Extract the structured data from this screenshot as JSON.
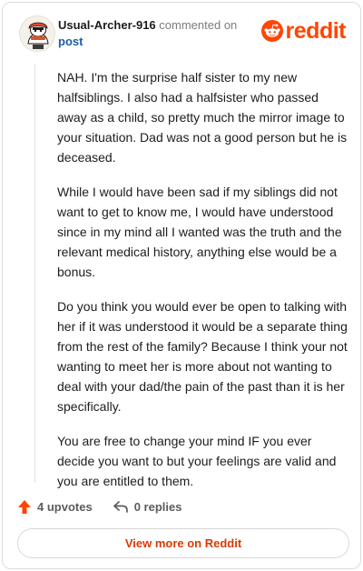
{
  "comment": {
    "username": "Usual-Archer-916",
    "action_text": "commented on",
    "target_text": "post",
    "paragraphs": [
      "NAH. I'm the surprise half sister to my new halfsiblings. I also had a halfsister who passed away as a child, so pretty much the mirror image to your situation. Dad was not a good person but he is deceased.",
      "While I would have been sad if my siblings did not want to get to know me, I would have understood since in my mind all I wanted was the truth and the relevant medical history, anything else would be a bonus.",
      "Do you think you would ever be open to talking with her if it was understood it would be a separate thing from the rest of the family? Because I think your not wanting to meet her is more about not wanting to deal with your dad/the pain of the past than it is her specifically.",
      "You are free to change your mind IF you ever decide you want to but your feelings are valid and you are entitled to them."
    ]
  },
  "brand": {
    "logo_text": "reddit",
    "color": "#ff4500"
  },
  "actions": {
    "upvotes_label": "4 upvotes",
    "replies_label": "0 replies",
    "upvote_icon": "upvote-arrow-icon",
    "reply_icon": "reply-arrow-icon"
  },
  "footer": {
    "view_more_label": "View more on Reddit"
  }
}
